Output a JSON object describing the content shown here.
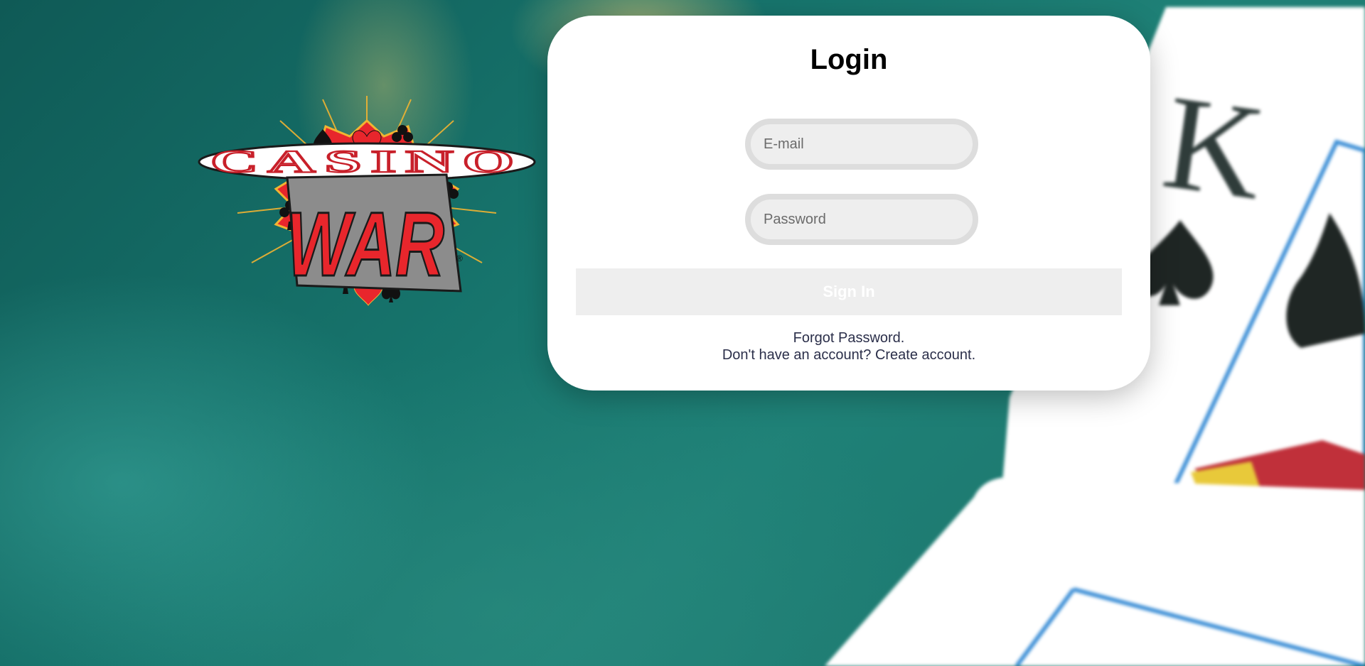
{
  "logo": {
    "top_text": "CASINO",
    "bottom_text": "WAR",
    "mark": "®"
  },
  "login": {
    "title": "Login",
    "email_placeholder": "E-mail",
    "password_placeholder": "Password",
    "signin_label": "Sign In",
    "forgot_password": "Forgot Password.",
    "no_account_prefix": "Don't have an account?",
    "create_account": "Create account."
  },
  "colors": {
    "background": "#17756d",
    "card": "#ffffff",
    "input_fill": "#eeeeee",
    "input_border": "#dddddd",
    "button_fill": "#eeeeee",
    "link_text": "#2b2f4a",
    "logo_red": "#e8262c"
  },
  "icons": {
    "card_suits": [
      "spade-icon",
      "heart-icon",
      "club-icon"
    ]
  }
}
